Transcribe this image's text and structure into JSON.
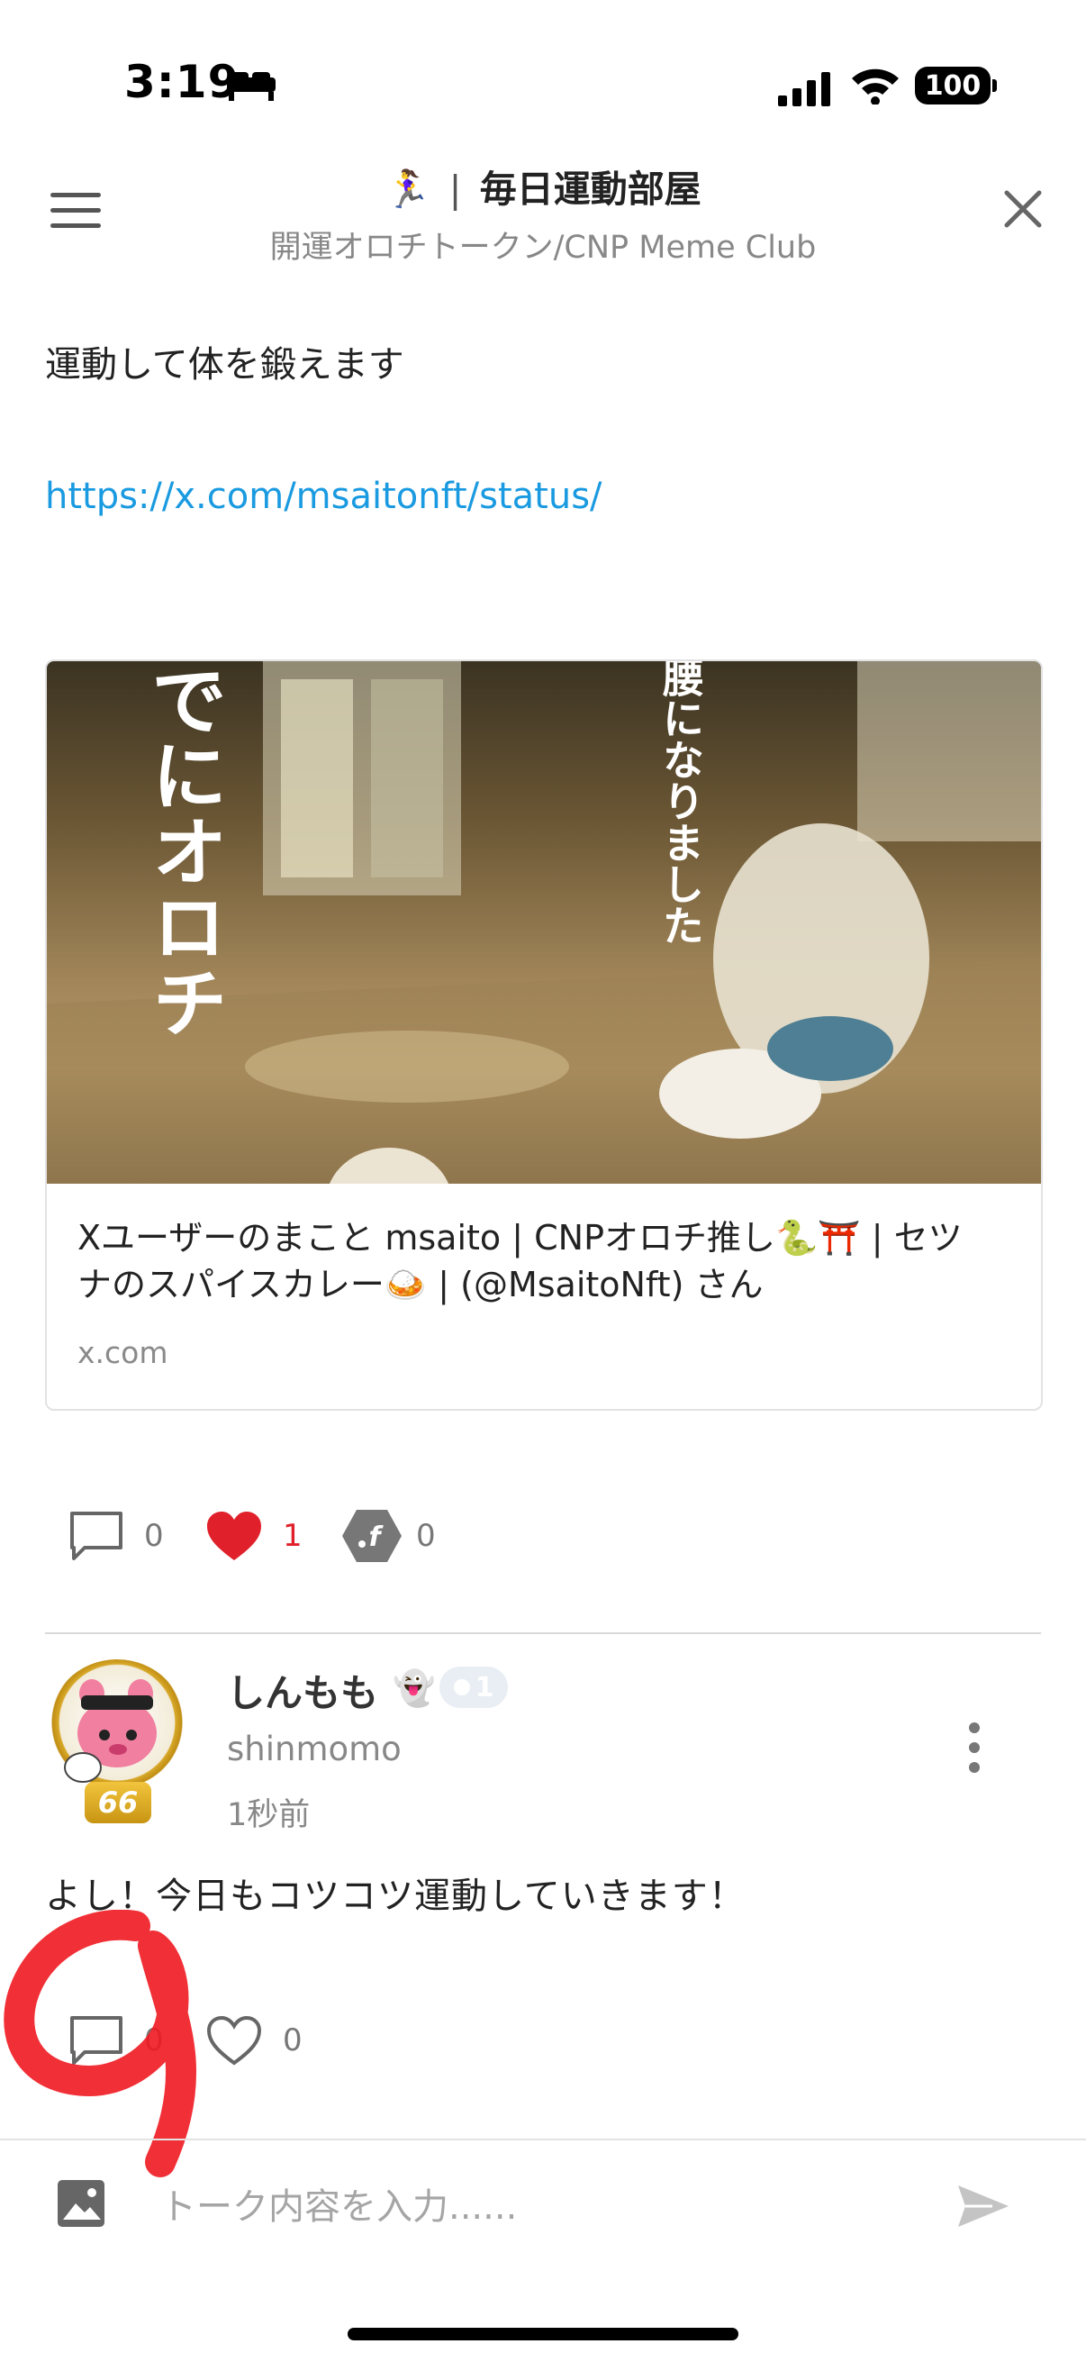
{
  "status_bar": {
    "time": "3:19",
    "battery": "100"
  },
  "header": {
    "emoji": "🏃‍♀️",
    "separator": "|",
    "title": "毎日運動部屋",
    "subtitle": "開運オロチトークン/CNP Meme Club"
  },
  "post": {
    "text": "運動して体を鍛えます",
    "link": "https://x.com/msaitonft/status/",
    "card": {
      "image_text_left": "でにオロチ",
      "image_text_right": "腰になりました",
      "title_line1": "Xユーザーのまこと msaito | CNPオロチ推し🐍⛩️ | セツ",
      "title_line2": "ナのスパイスカレー🍛 | (@MsaitoNft) さん",
      "domain": "x.com"
    },
    "actions": {
      "comments": "0",
      "likes": "1",
      "coins": "0"
    }
  },
  "comment": {
    "username": "しんもも",
    "user_emoji": "👻",
    "level": "1",
    "avatar_badge": "66",
    "handle": "shinmomo",
    "time_ago": "1秒前",
    "text": "よし！今日もコツコツ運動していきます！",
    "actions": {
      "comments": "0",
      "likes": "0"
    }
  },
  "input_bar": {
    "placeholder": "トーク内容を入力......"
  },
  "colors": {
    "link": "#1a9ae0",
    "like_red": "#e0202a",
    "annotation_red": "#f01820"
  }
}
